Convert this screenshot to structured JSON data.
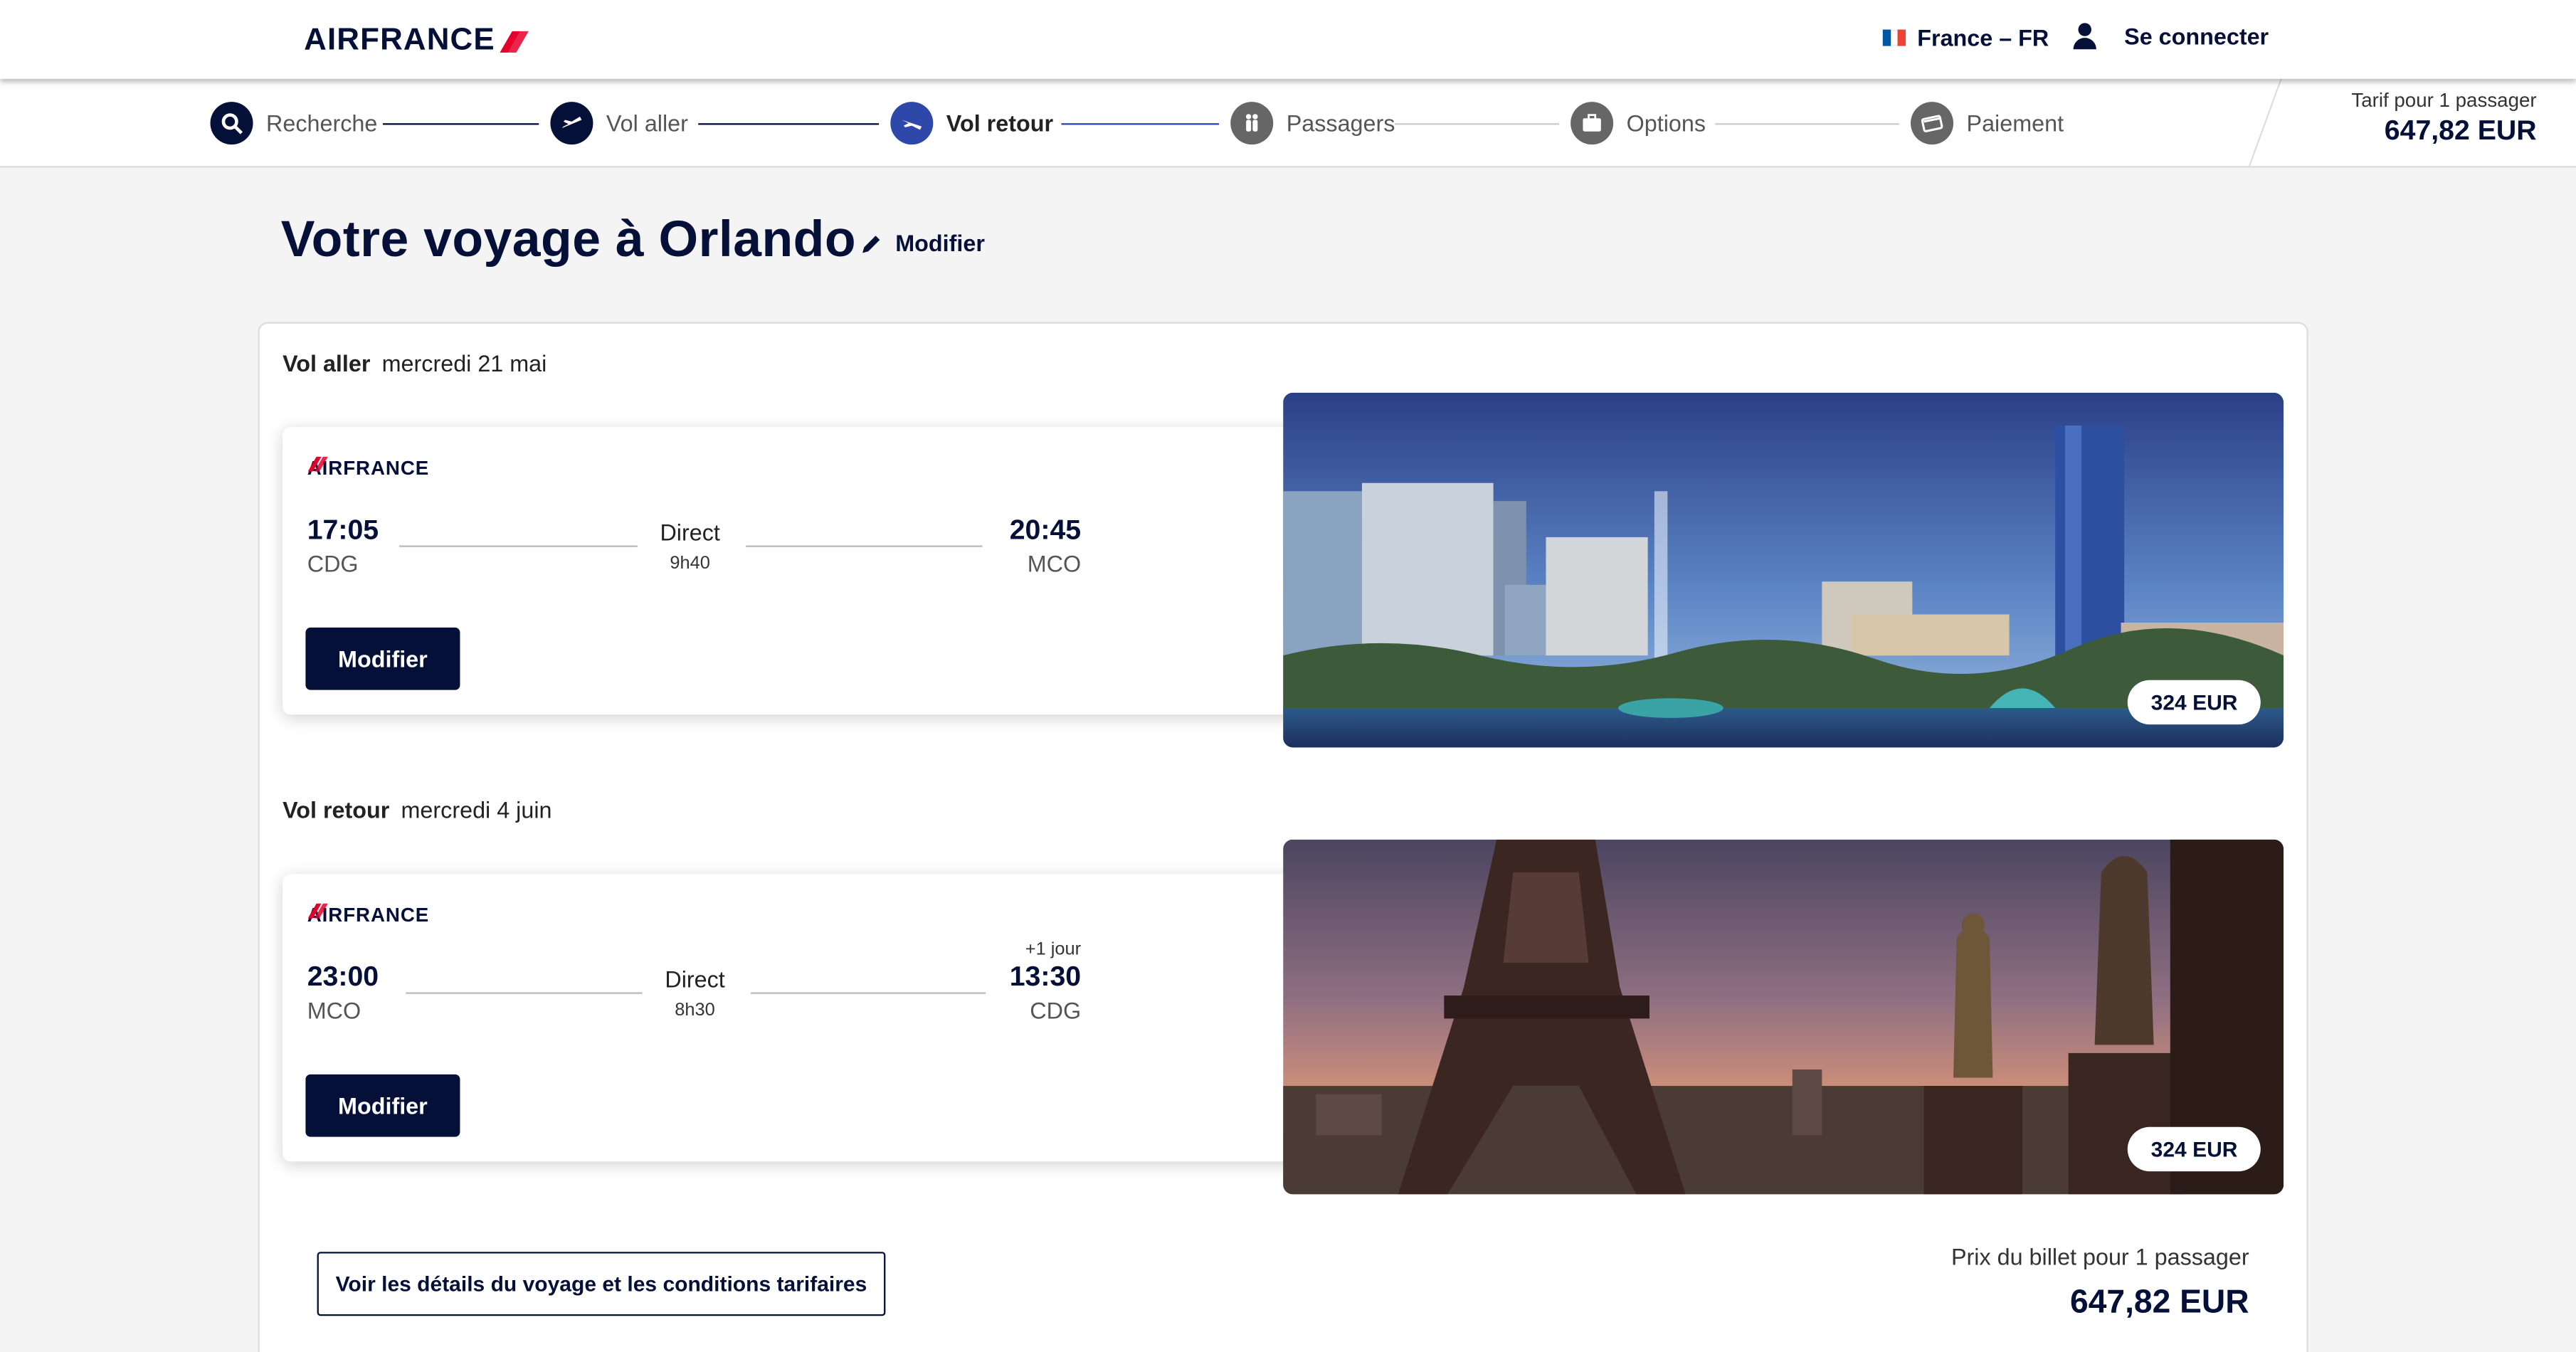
{
  "header": {
    "logo_text": "AIRFRANCE",
    "locale": "France – FR",
    "signin_label": "Se connecter",
    "flag_colors": [
      "#0055a4",
      "#ffffff",
      "#ef4135"
    ]
  },
  "stepper": {
    "steps": [
      {
        "label": "Recherche",
        "state": "done",
        "icon": "search-icon"
      },
      {
        "label": "Vol aller",
        "state": "done",
        "icon": "plane-departure-icon"
      },
      {
        "label": "Vol retour",
        "state": "active",
        "icon": "plane-arrival-icon"
      },
      {
        "label": "Passagers",
        "state": "pending",
        "icon": "passengers-icon"
      },
      {
        "label": "Options",
        "state": "pending",
        "icon": "briefcase-icon"
      },
      {
        "label": "Paiement",
        "state": "pending",
        "icon": "credit-card-icon"
      }
    ],
    "fare_label": "Tarif pour 1 passager",
    "fare_value": "647,82 EUR"
  },
  "page": {
    "title": "Votre voyage à Orlando",
    "edit_label": "Modifier"
  },
  "outbound": {
    "heading_label": "Vol aller",
    "date": "mercredi 21 mai",
    "airline": "AIRFRANCE",
    "depart_time": "17:05",
    "depart_code": "CDG",
    "arrive_time": "20:45",
    "arrive_code": "MCO",
    "stops": "Direct",
    "duration": "9h40",
    "modify_label": "Modifier",
    "price": "324 EUR"
  },
  "inbound": {
    "heading_label": "Vol retour",
    "date": "mercredi 4 juin",
    "airline": "AIRFRANCE",
    "depart_time": "23:00",
    "depart_code": "MCO",
    "arrive_time": "13:30",
    "arrive_code": "CDG",
    "next_day": "+1 jour",
    "stops": "Direct",
    "duration": "8h30",
    "modify_label": "Modifier",
    "price": "324 EUR"
  },
  "footer": {
    "details_label": "Voir les détails du voyage et les conditions tarifaires",
    "total_label": "Prix du billet pour 1 passager",
    "total_value": "647,82 EUR"
  },
  "colors": {
    "brand_navy": "#051039",
    "active_blue": "#2d48a8",
    "brand_red": "#e4002b"
  }
}
